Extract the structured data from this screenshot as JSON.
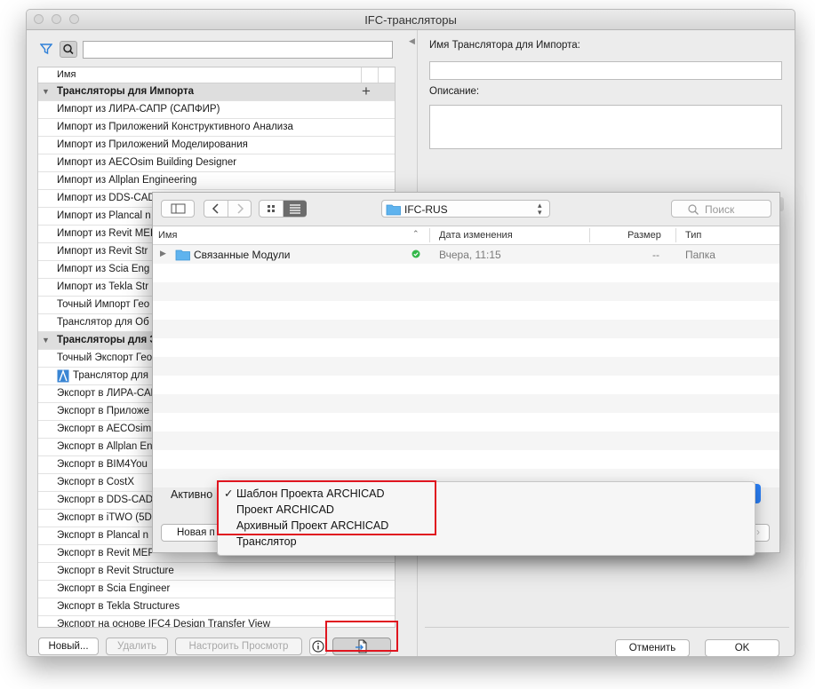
{
  "window": {
    "title": "IFC-трансляторы"
  },
  "left": {
    "search_value": "",
    "column_name": "Имя",
    "groups": [
      {
        "label": "Трансляторы для Импорта",
        "items": [
          "Импорт из ЛИРА-САПР (САПФИР)",
          "Импорт из Приложений Конструктивного Анализа",
          "Импорт из Приложений Моделирования",
          "Импорт из AECOsim Building Designer",
          "Импорт из Allplan Engineering",
          "Импорт из DDS-CAD",
          "Импорт из Plancal n",
          "Импорт из Revit MEP",
          "Импорт из Revit Str",
          "Импорт из Scia Eng",
          "Импорт из Tekla Str",
          "Точный Импорт Гео",
          "Транслятор для Об"
        ]
      },
      {
        "label": "Трансляторы для Э",
        "items": [
          "Точный Экспорт Гео",
          "Транслятор для",
          "Экспорт в ЛИРА-САП",
          "Экспорт в Приложе",
          "Экспорт в AECOsim",
          "Экспорт в Allplan En",
          "Экспорт в BIM4You",
          "Экспорт в CostX",
          "Экспорт в DDS-CAD",
          "Экспорт в iTWO (5D",
          "Экспорт в Plancal n",
          "Экспорт в Revit MEP",
          "Экспорт в Revit Structure",
          "Экспорт в Scia Engineer",
          "Экспорт в Tekla Structures",
          "Экспорт на основе IFC4 Design Transfer View"
        ]
      }
    ],
    "buttons": {
      "new": "Новый...",
      "delete": "Удалить",
      "configure_view": "Настроить Просмотр"
    }
  },
  "right": {
    "import_name_label": "Имя Транслятора для Импорта:",
    "import_name_value": "",
    "description_label": "Описание:",
    "description_value": "",
    "cancel": "Отменить",
    "ok": "OK"
  },
  "dialog": {
    "location": "IFC-RUS",
    "search_placeholder": "Поиск",
    "columns": {
      "name": "Имя",
      "date": "Дата изменения",
      "size": "Размер",
      "kind": "Тип"
    },
    "rows": [
      {
        "name": "Связанные Модули",
        "date": "Вчера, 11:15",
        "size": "--",
        "kind": "Папка"
      }
    ],
    "active_label": "Активно",
    "new_button": "Новая п"
  },
  "menu": {
    "checkmark": "✓",
    "items": [
      "Шаблон Проекта ARCHICAD",
      "Проект ARCHICAD",
      "Архивный Проект ARCHICAD",
      "Транслятор"
    ],
    "selected_index": 0
  }
}
